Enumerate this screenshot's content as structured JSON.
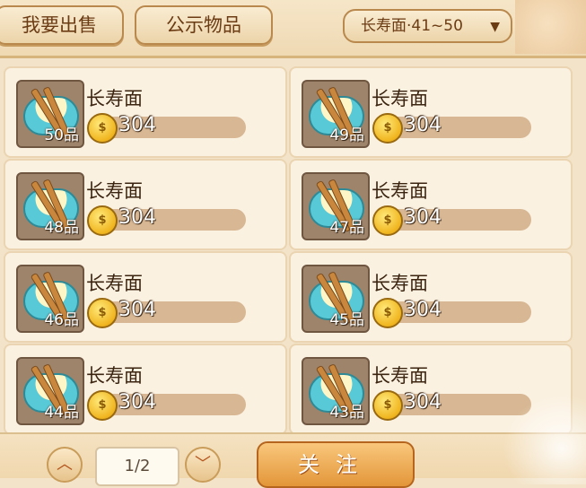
{
  "tabs": {
    "sell_label": "我要出售",
    "public_label": "公示物品"
  },
  "filter": {
    "label": "长寿面·41~50"
  },
  "items": [
    {
      "name": "长寿面",
      "grade": "50品",
      "price": "304"
    },
    {
      "name": "长寿面",
      "grade": "49品",
      "price": "304"
    },
    {
      "name": "长寿面",
      "grade": "48品",
      "price": "304"
    },
    {
      "name": "长寿面",
      "grade": "47品",
      "price": "304"
    },
    {
      "name": "长寿面",
      "grade": "46品",
      "price": "304"
    },
    {
      "name": "长寿面",
      "grade": "45品",
      "price": "304"
    },
    {
      "name": "长寿面",
      "grade": "44品",
      "price": "304"
    },
    {
      "name": "长寿面",
      "grade": "43品",
      "price": "304"
    }
  ],
  "pagination": {
    "page_label": "1/2"
  },
  "actions": {
    "follow_label": "关注"
  },
  "icons": {
    "coin": "gold-coin-icon",
    "up": "chevron-up-icon",
    "down": "chevron-down-icon",
    "dropdown": "triangle-down-icon"
  }
}
